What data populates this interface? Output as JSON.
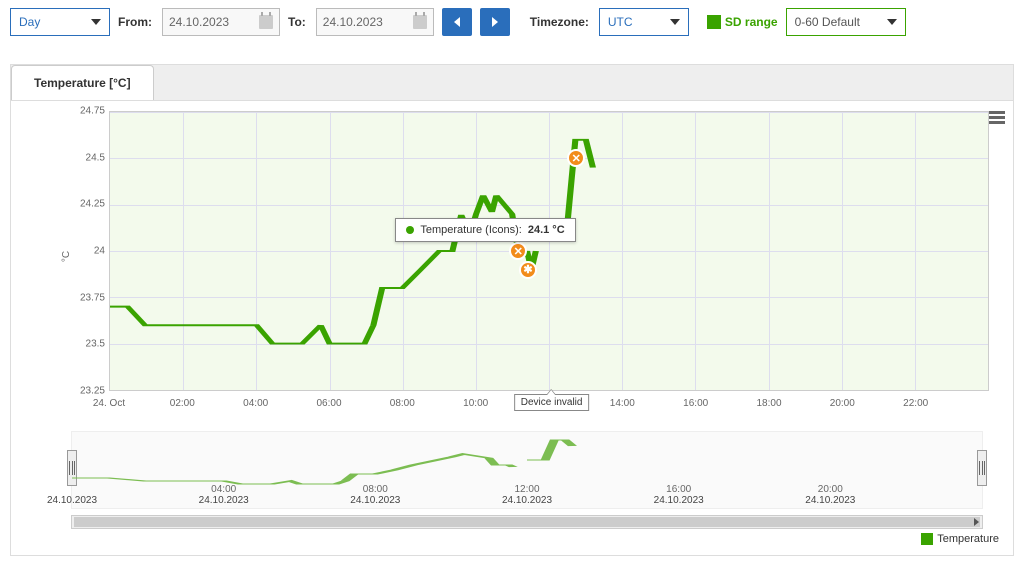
{
  "toolbar": {
    "period_label": "Day",
    "from_label": "From:",
    "from_value": "24.10.2023",
    "to_label": "To:",
    "to_value": "24.10.2023",
    "timezone_label": "Timezone:",
    "timezone_value": "UTC",
    "sd_range_label": "SD range",
    "sd_range_value": "0-60 Default"
  },
  "tabs": {
    "active": "Temperature [°C]"
  },
  "chart": {
    "y_unit": "°C",
    "y_ticks": [
      "24.75",
      "24.5",
      "24.25",
      "24",
      "23.75",
      "23.5",
      "23.25"
    ],
    "x_ticks": [
      "24. Oct",
      "02:00",
      "04:00",
      "06:00",
      "08:00",
      "10:00",
      "12:00",
      "14:00",
      "16:00",
      "18:00",
      "20:00",
      "22:00"
    ],
    "tooltip": {
      "series": "Temperature (Icons):",
      "value": "24.1 °C"
    },
    "flag_label": "Device invalid"
  },
  "navigator": {
    "x_ticks": [
      {
        "time": "",
        "date": "24.10.2023"
      },
      {
        "time": "04:00",
        "date": "24.10.2023"
      },
      {
        "time": "08:00",
        "date": "24.10.2023"
      },
      {
        "time": "12:00",
        "date": "24.10.2023"
      },
      {
        "time": "16:00",
        "date": "24.10.2023"
      },
      {
        "time": "20:00",
        "date": "24.10.2023"
      }
    ]
  },
  "legend": {
    "series": "Temperature"
  },
  "chart_data": {
    "type": "line",
    "title": "Temperature [°C]",
    "xlabel": "",
    "ylabel": "°C",
    "ylim": [
      23.25,
      24.75
    ],
    "x": [
      "00:00",
      "00:30",
      "01:00",
      "02:00",
      "04:00",
      "04:30",
      "05:15",
      "05:45",
      "06:00",
      "07:00",
      "07:30",
      "08:00",
      "08:30",
      "09:00",
      "09:30",
      "10:00",
      "10:30",
      "11:00",
      "11:15",
      "11:30",
      "12:00",
      "12:30",
      "13:00"
    ],
    "series": [
      {
        "name": "Temperature",
        "values": [
          23.7,
          23.7,
          23.6,
          23.6,
          23.6,
          23.5,
          23.5,
          23.6,
          23.5,
          23.6,
          23.8,
          23.8,
          23.9,
          24.0,
          24.2,
          24.2,
          24.3,
          24.0,
          24.0,
          23.9,
          null,
          24.1,
          24.6
        ]
      }
    ],
    "markers": [
      {
        "x": "11:10",
        "y": 24.0,
        "label": "x"
      },
      {
        "x": "11:25",
        "y": 23.9,
        "label": "*"
      },
      {
        "x": "12:05",
        "y": 24.1,
        "label": "x"
      },
      {
        "x": "12:45",
        "y": 24.5,
        "label": "x"
      }
    ],
    "annotations": [
      {
        "x": "12:05",
        "text": "Device invalid"
      }
    ]
  }
}
